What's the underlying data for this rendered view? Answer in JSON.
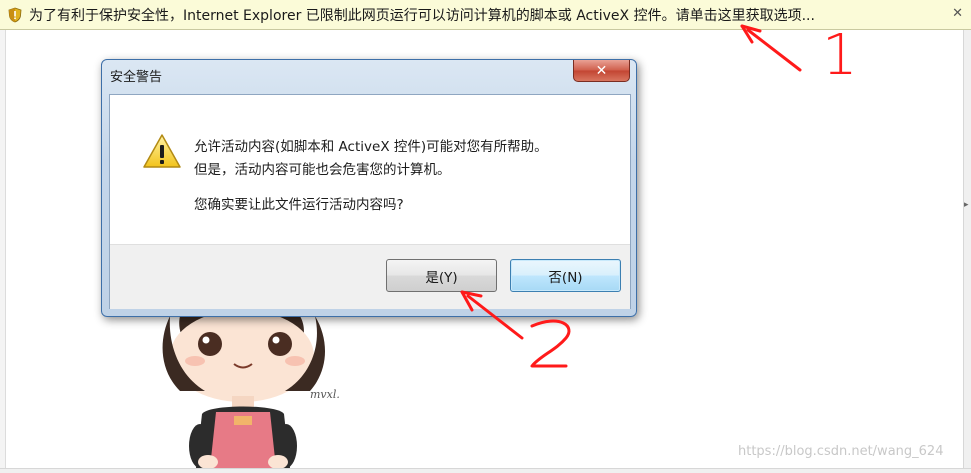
{
  "infobar": {
    "message": "为了有利于保护安全性，Internet Explorer 已限制此网页运行可以访问计算机的脚本或 ActiveX 控件。请单击这里获取选项...",
    "close_glyph": "✕"
  },
  "dialog": {
    "title": "安全警告",
    "close_glyph": "✕",
    "line1": "允许活动内容(如脚本和 ActiveX 控件)可能对您有所帮助。",
    "line2": "但是，活动内容可能也会危害您的计算机。",
    "line3": "您确实要让此文件运行活动内容吗?",
    "yes_label": "是(Y)",
    "no_label": "否(N)"
  },
  "figure": {
    "signature": "mvxl."
  },
  "watermark": "https://blog.csdn.net/wang_624",
  "annotations": {
    "number1": "1",
    "number2": "2",
    "color": "#ff1a1a"
  },
  "colors": {
    "infobar_bg": "#fbfbd8",
    "dialog_frame": "#c4d6ea",
    "close_button": "#c34532",
    "default_button": "#bee6fd"
  }
}
